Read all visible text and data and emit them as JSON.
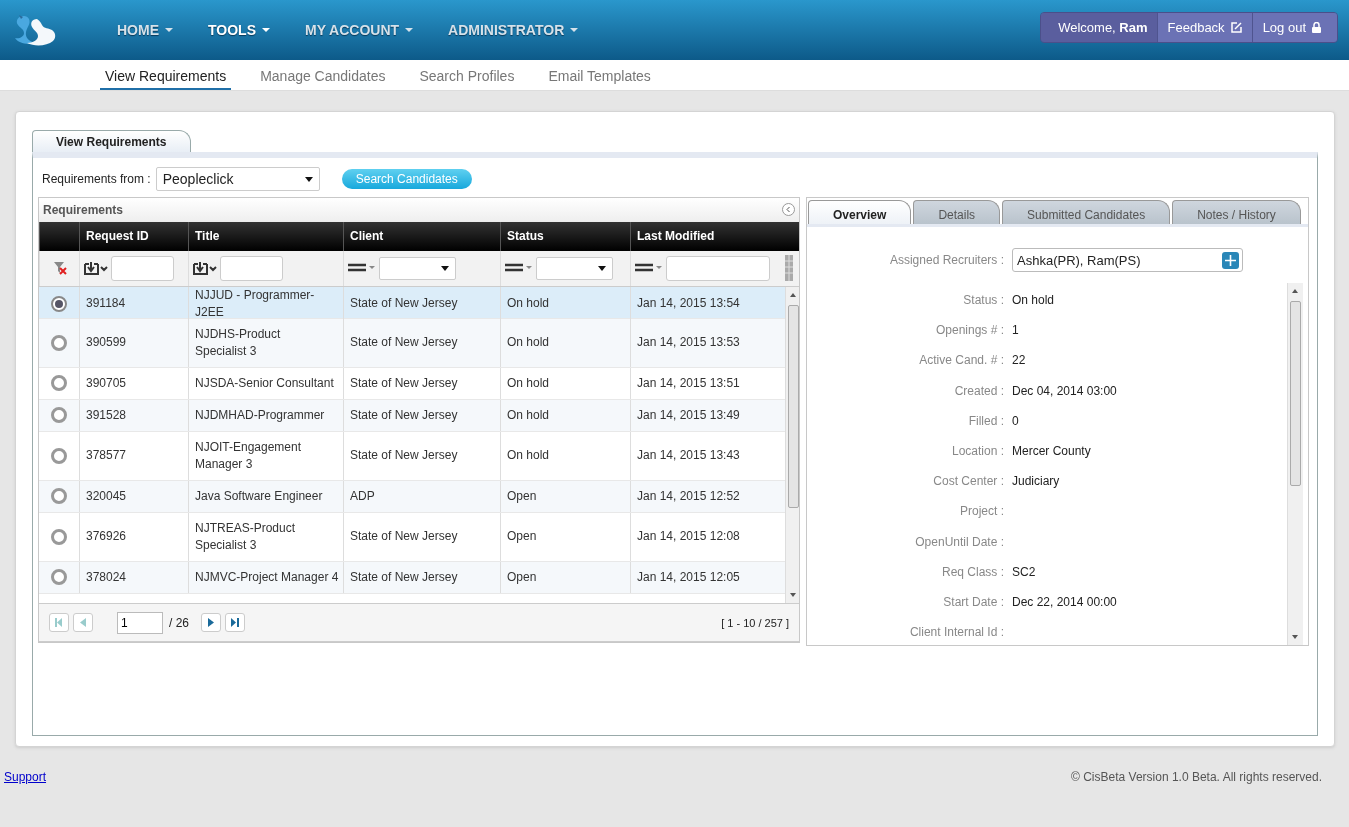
{
  "header": {
    "menu": [
      {
        "label": "HOME",
        "selected": false
      },
      {
        "label": "TOOLS",
        "selected": true
      },
      {
        "label": "MY ACCOUNT",
        "selected": false
      },
      {
        "label": "ADMINISTRATOR",
        "selected": false
      }
    ],
    "welcome": "Welcome, **Ram**",
    "feedback": "Feedback",
    "logout": "Log out"
  },
  "subnav": [
    {
      "label": "View Requirements",
      "selected": true
    },
    {
      "label": "Manage Candidates",
      "selected": false
    },
    {
      "label": "Search Profiles",
      "selected": false
    },
    {
      "label": "Email Templates",
      "selected": false
    }
  ],
  "page_tab": "View Requirements",
  "source": {
    "label": "Requirements from :",
    "value": "Peopleclick",
    "button": "Search Candidates"
  },
  "grid": {
    "title": "Requirements",
    "columns": [
      {
        "label": "Request ID",
        "kind": "text"
      },
      {
        "label": "Title",
        "kind": "text"
      },
      {
        "label": "Client",
        "kind": "select"
      },
      {
        "label": "Status",
        "kind": "select"
      },
      {
        "label": "Last Modified",
        "kind": "date"
      }
    ],
    "rows": [
      {
        "selected": true,
        "request_id": "391184",
        "title": "NJJUD - Programmer-J2EE",
        "client": "State of New Jersey",
        "status": "On hold",
        "last_modified": "Jan 14, 2015 13:54"
      },
      {
        "selected": false,
        "request_id": "390599",
        "title": "NJDHS-Product Specialist 3",
        "client": "State of New Jersey",
        "status": "On hold",
        "last_modified": "Jan 14, 2015 13:53"
      },
      {
        "selected": false,
        "request_id": "390705",
        "title": "NJSDA-Senior Consultant",
        "client": "State of New Jersey",
        "status": "On hold",
        "last_modified": "Jan 14, 2015 13:51"
      },
      {
        "selected": false,
        "request_id": "391528",
        "title": "NJDMHAD-Programmer",
        "client": "State of New Jersey",
        "status": "On hold",
        "last_modified": "Jan 14, 2015 13:49"
      },
      {
        "selected": false,
        "request_id": "378577",
        "title": "NJOIT-Engagement Manager 3",
        "client": "State of New Jersey",
        "status": "On hold",
        "last_modified": "Jan 14, 2015 13:43"
      },
      {
        "selected": false,
        "request_id": "320045",
        "title": "Java Software Engineer",
        "client": "ADP",
        "status": "Open",
        "last_modified": "Jan 14, 2015 12:52"
      },
      {
        "selected": false,
        "request_id": "376926",
        "title": "NJTREAS-Product Specialist 3",
        "client": "State of New Jersey",
        "status": "Open",
        "last_modified": "Jan 14, 2015 12:08"
      },
      {
        "selected": false,
        "request_id": "378024",
        "title": "NJMVC-Project Manager 4",
        "client": "State of New Jersey",
        "status": "Open",
        "last_modified": "Jan 14, 2015 12:05"
      }
    ],
    "pager": {
      "page": "1",
      "total": "/ 26",
      "range": "[ 1 - 10 / 257 ]"
    }
  },
  "details": {
    "tabs": [
      {
        "label": "Overview",
        "selected": true
      },
      {
        "label": "Details",
        "selected": false
      },
      {
        "label": "Submitted Candidates",
        "selected": false
      },
      {
        "label": "Notes / History",
        "selected": false
      }
    ],
    "recruiters_label": "Assigned Recruiters :",
    "recruiters": "Ashka(PR), Ram(PS)",
    "fields": [
      {
        "label": "Status :",
        "value": "On hold"
      },
      {
        "label": "Openings # :",
        "value": "1"
      },
      {
        "label": "Active Cand. # :",
        "value": "22"
      },
      {
        "label": "Created :",
        "value": "Dec 04, 2014 03:00"
      },
      {
        "label": "Filled :",
        "value": "0"
      },
      {
        "label": "Location :",
        "value": "Mercer County"
      },
      {
        "label": "Cost Center :",
        "value": "Judiciary"
      },
      {
        "label": "Project :"
      },
      {
        "label": "OpenUntil Date :"
      },
      {
        "label": "Req Class :",
        "value": "SC2"
      },
      {
        "label": "Start Date :",
        "value": "Dec 22, 2014 00:00"
      },
      {
        "label": "Client Internal Id :"
      }
    ]
  },
  "footer": {
    "support": "Support",
    "copyright": "© CisBeta Version 1.0 Beta. All rights reserved."
  }
}
